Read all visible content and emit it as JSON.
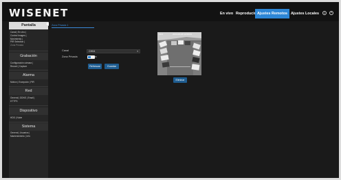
{
  "brand": {
    "logo": "WISENET"
  },
  "topnav": {
    "items": [
      "En vivo",
      "Reproducir",
      "Ajustes Remotos",
      "Ajustes Locales"
    ],
    "active": "Ajustes Remotos"
  },
  "top_icons": [
    "info-icon",
    "power-icon"
  ],
  "sidebar": {
    "sections": [
      {
        "title": "Pantalla",
        "active": true,
        "items": [
          "Canal",
          "En vivo",
          "Control Imagen",
          "Movimiento",
          "PIR Selection",
          "Zona Privada"
        ],
        "current_item": "Zona Privada"
      },
      {
        "title": "Grabación",
        "active": false,
        "items": [
          "Configuración cámara",
          "Record",
          "Capture"
        ]
      },
      {
        "title": "Alarma",
        "active": false,
        "items": [
          "Motion",
          "Excepción",
          "PIR"
        ]
      },
      {
        "title": "Red",
        "active": false,
        "items": [
          "General",
          "DDNS",
          "Email",
          "HTTPS"
        ]
      },
      {
        "title": "Dispositivo",
        "active": false,
        "items": [
          "HDD",
          "Nube"
        ]
      },
      {
        "title": "Sistema",
        "active": false,
        "items": [
          "General",
          "Usuarios",
          "Mantenimiento",
          "Info"
        ]
      }
    ]
  },
  "page": {
    "tab": "Zona Privada 1",
    "form": {
      "canal_label": "Canal",
      "canal_value": "CH04",
      "zona_label": "Zona Privada",
      "switch_state": "On",
      "refresh_label": "Refrescar",
      "save_label": "Guardar"
    },
    "preview": {
      "label": "CH4",
      "timestamp": "2024-06-18 12:09:03"
    },
    "delete_label": "Eliminar"
  },
  "colors": {
    "accent": "#2d86d6",
    "button": "#1f5d91",
    "topbar": "#121212",
    "sidebar": "#262626",
    "background": "#1a1a1a"
  }
}
